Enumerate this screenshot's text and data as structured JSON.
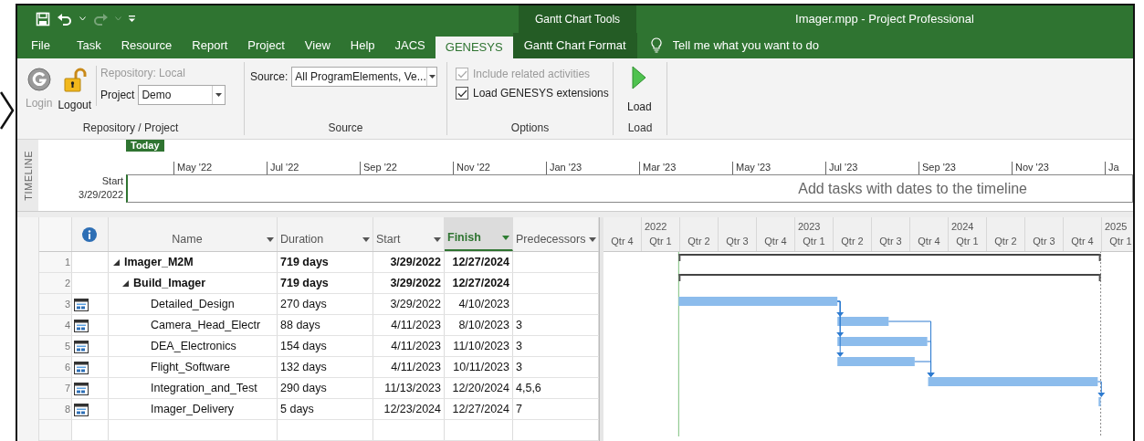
{
  "title_bar": {
    "contextual_label": "Gantt Chart Tools",
    "title": "Imager.mpp  -  Project Professional",
    "redo_disabled": true
  },
  "tabs": [
    {
      "label": "File",
      "selected": false,
      "kind": "normal"
    },
    {
      "label": "Task",
      "selected": false,
      "kind": "normal"
    },
    {
      "label": "Resource",
      "selected": false,
      "kind": "normal"
    },
    {
      "label": "Report",
      "selected": false,
      "kind": "normal"
    },
    {
      "label": "Project",
      "selected": false,
      "kind": "normal"
    },
    {
      "label": "View",
      "selected": false,
      "kind": "normal"
    },
    {
      "label": "Help",
      "selected": false,
      "kind": "normal"
    },
    {
      "label": "JACS",
      "selected": false,
      "kind": "normal"
    },
    {
      "label": "GENESYS",
      "selected": true,
      "kind": "normal"
    },
    {
      "label": "Gantt Chart Format",
      "selected": false,
      "kind": "contextual"
    }
  ],
  "tell_me": {
    "placeholder": "Tell me what you want to do"
  },
  "ribbon": {
    "account": {
      "login": {
        "label": "Login",
        "disabled": true
      },
      "logout": "Logout",
      "repository": "Repository: Local",
      "project_label": "Project",
      "project_value": "Demo",
      "group": "Repository / Project"
    },
    "source": {
      "label": "Source:",
      "value": "All ProgramElements, Ve...",
      "group": "Source"
    },
    "options": {
      "checkboxes": [
        {
          "label": "Include related activities",
          "checked": true,
          "disabled": true
        },
        {
          "label": "Load GENESYS extensions",
          "checked": true,
          "disabled": false
        }
      ],
      "group": "Options"
    },
    "load": {
      "button": "Load",
      "group": "Load"
    }
  },
  "timeline": {
    "side_label": "TIMELINE",
    "today": "Today",
    "start_label": "Start",
    "start_date": "3/29/2022",
    "months": [
      "May '22",
      "Jul '22",
      "Sep '22",
      "Nov '22",
      "Jan '23",
      "Mar '23",
      "May '23",
      "Jul '23",
      "Sep '23",
      "Nov '23",
      "Ja"
    ],
    "hint": "Add tasks with dates to the timeline"
  },
  "table": {
    "columns": [
      {
        "label": "Name",
        "selected": false
      },
      {
        "label": "Duration",
        "selected": false
      },
      {
        "label": "Start",
        "selected": false
      },
      {
        "label": "Finish",
        "selected": true
      },
      {
        "label": "Predecessors",
        "selected": false
      }
    ],
    "rows": [
      {
        "id": "1",
        "name": "Imager_M2M",
        "duration": "719 days",
        "start": "3/29/2022",
        "finish": "12/27/2024",
        "kind": "summary",
        "expanded": true,
        "children": [
          {
            "id": "2",
            "name": "Build_Imager",
            "duration": "719 days",
            "start": "3/29/2022",
            "finish": "12/27/2024",
            "kind": "summary",
            "expanded": true,
            "children": [
              {
                "id": "3",
                "name": "Detailed_Design",
                "duration": "270 days",
                "start": "3/29/2022",
                "finish": "4/10/2023",
                "kind": "task"
              },
              {
                "id": "4",
                "name": "Camera_Head_Electr",
                "duration": "88 days",
                "start": "4/11/2023",
                "finish": "8/10/2023",
                "predecessors": "3",
                "kind": "task"
              },
              {
                "id": "5",
                "name": "DEA_Electronics",
                "duration": "154 days",
                "start": "4/11/2023",
                "finish": "11/10/2023",
                "predecessors": "3",
                "kind": "task"
              },
              {
                "id": "6",
                "name": "Flight_Software",
                "duration": "132 days",
                "start": "4/11/2023",
                "finish": "10/11/2023",
                "predecessors": "3",
                "kind": "task"
              },
              {
                "id": "7",
                "name": "Integration_and_Test",
                "duration": "290 days",
                "start": "11/13/2023",
                "finish": "12/20/2024",
                "predecessors": "4,5,6",
                "kind": "task"
              },
              {
                "id": "8",
                "name": "Imager_Delivery",
                "duration": "5 days",
                "start": "12/23/2024",
                "finish": "12/27/2024",
                "predecessors": "7",
                "kind": "task"
              }
            ]
          }
        ]
      }
    ]
  },
  "gantt": {
    "quarters": [
      {
        "label": "Qtr 4"
      },
      {
        "label": "Qtr 1",
        "year": "2022"
      },
      {
        "label": "Qtr 2"
      },
      {
        "label": "Qtr 3"
      },
      {
        "label": "Qtr 4"
      },
      {
        "label": "Qtr 1",
        "year": "2023"
      },
      {
        "label": "Qtr 2"
      },
      {
        "label": "Qtr 3"
      },
      {
        "label": "Qtr 4"
      },
      {
        "label": "Qtr 1",
        "year": "2024"
      },
      {
        "label": "Qtr 2"
      },
      {
        "label": "Qtr 3"
      },
      {
        "label": "Qtr 4"
      },
      {
        "label": "Qtr 1",
        "year": "2025"
      }
    ]
  }
}
